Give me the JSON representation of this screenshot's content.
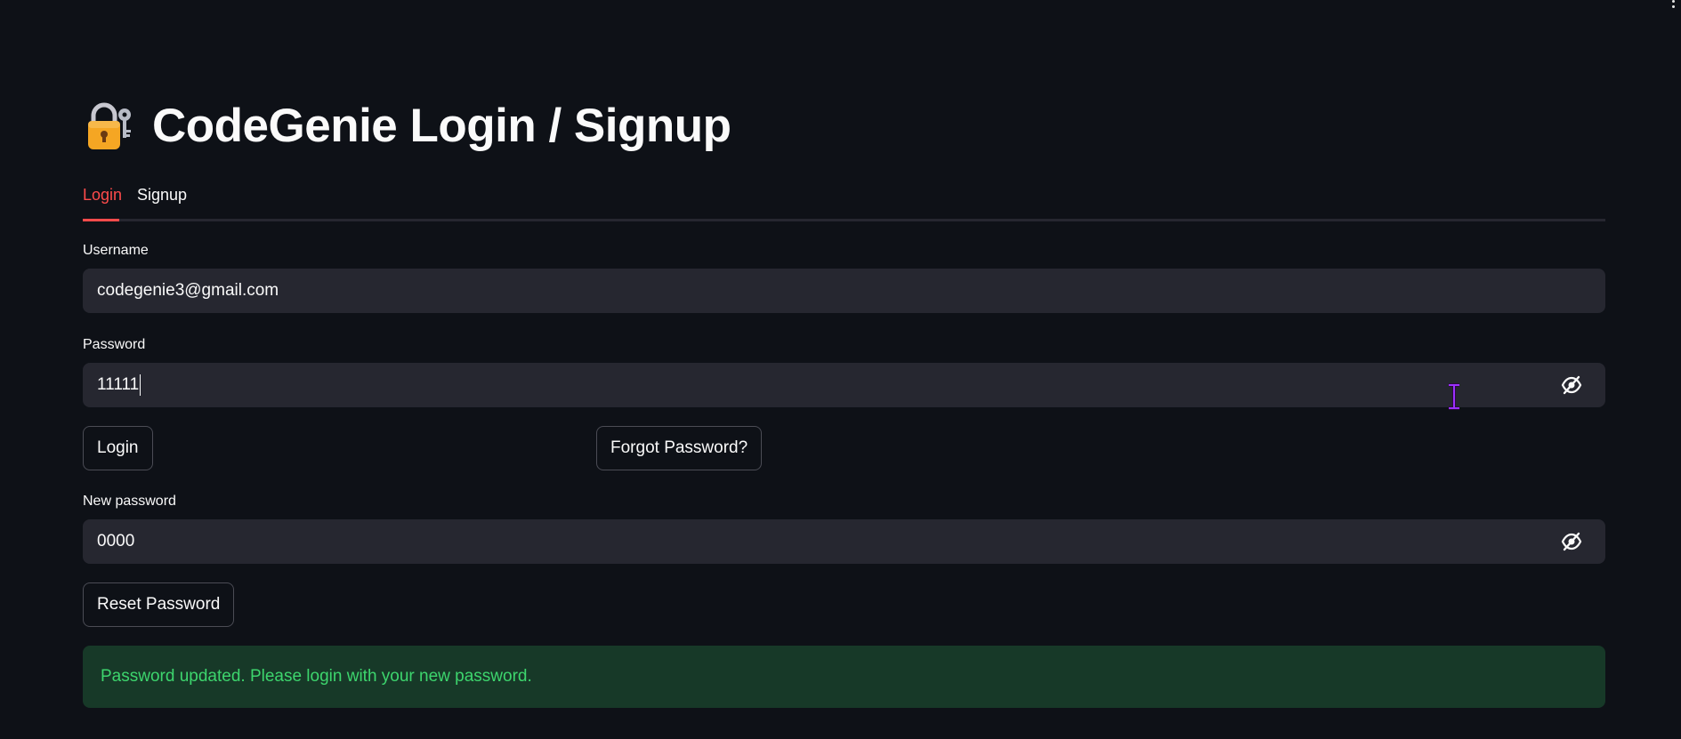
{
  "header": {
    "title": "CodeGenie Login / Signup",
    "icon": "lock-with-key-icon"
  },
  "tabs": [
    {
      "label": "Login",
      "active": true
    },
    {
      "label": "Signup",
      "active": false
    }
  ],
  "login_form": {
    "username_label": "Username",
    "username_value": "codegenie3@gmail.com",
    "password_label": "Password",
    "password_value": "11111",
    "login_button": "Login",
    "forgot_button": "Forgot Password?",
    "new_password_label": "New password",
    "new_password_value": "0000",
    "reset_button": "Reset Password"
  },
  "alert": {
    "type": "success",
    "message": "Password updated. Please login with your new password."
  },
  "colors": {
    "background": "#0e1117",
    "input_bg": "#262730",
    "accent": "#ff4b4b",
    "success_bg": "#173928",
    "success_text": "#3dd56d"
  }
}
